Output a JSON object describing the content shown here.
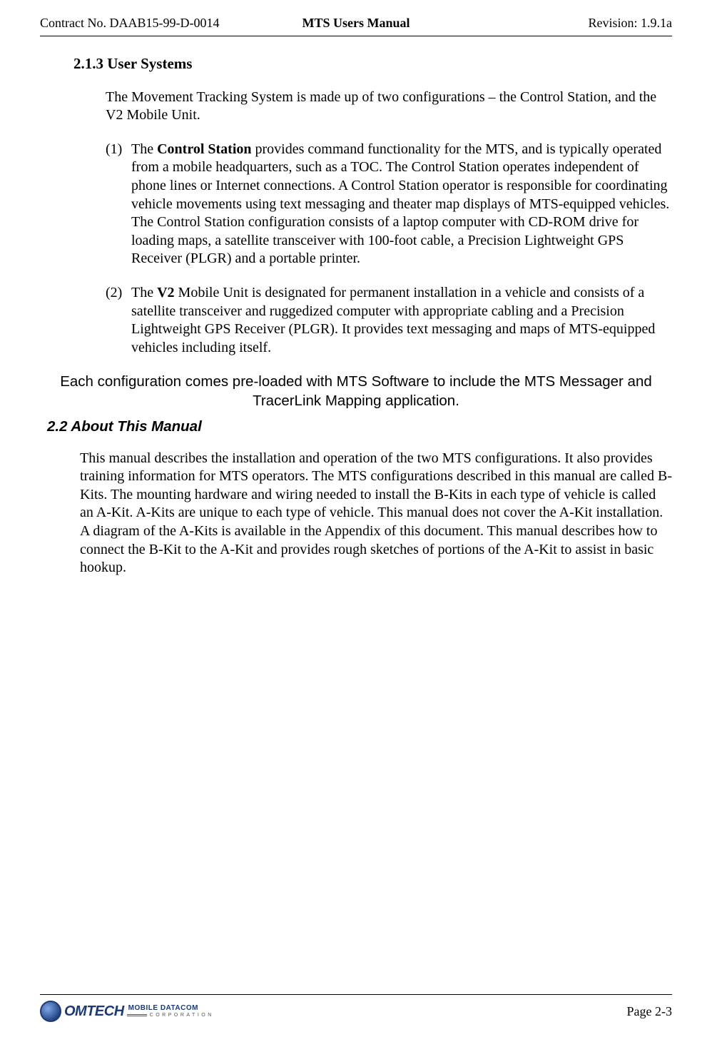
{
  "header": {
    "left": "Contract No. DAAB15-99-D-0014",
    "center": "MTS Users Manual",
    "right": "Revision:  1.9.1a"
  },
  "section_213": {
    "heading": "2.1.3  User Systems",
    "intro": "The Movement Tracking System is made up of two configurations – the Control Station, and the V2 Mobile Unit.",
    "items": [
      {
        "marker": "(1)",
        "bold_lead": "Control Station",
        "pre_bold": "The ",
        "post_bold": " provides command functionality for the MTS, and is typically operated from a mobile headquarters, such as a TOC.  The Control Station operates independent of phone lines or Internet connections.  A Control Station operator is responsible for coordinating vehicle movements using text messaging and theater map displays of MTS-equipped vehicles.  The Control Station configuration consists of a laptop computer with CD-ROM drive for loading maps, a satellite transceiver with 100-foot cable, a Precision Lightweight GPS Receiver (PLGR) and a portable printer."
      },
      {
        "marker": "(2)",
        "bold_lead": "V2",
        "pre_bold": "The ",
        "post_bold": " Mobile Unit is designated for permanent installation in a vehicle and consists of a satellite transceiver and ruggedized computer with appropriate cabling and a Precision Lightweight GPS Receiver (PLGR).  It provides text messaging and maps of MTS-equipped vehicles including itself."
      }
    ]
  },
  "note": "Each configuration comes pre-loaded with MTS Software to include the MTS Messager and TracerLink Mapping application.",
  "section_22": {
    "heading": "2.2  About This Manual",
    "para": "This manual describes the installation and operation of the two MTS configurations. It also provides training information for MTS operators.  The MTS configurations described in this manual are called B-Kits.  The mounting hardware and wiring needed to install the B-Kits in each type of vehicle is called an A-Kit.  A-Kits are unique to each type of vehicle.  This manual does not cover the A-Kit installation.  A diagram of the A-Kits is available in the Appendix of this document.  This manual describes how to connect the B-Kit to the A-Kit and provides rough sketches of portions of the A-Kit to assist in basic hookup."
  },
  "footer": {
    "page": "Page 2-3",
    "logo_main": "OMTECH",
    "logo_sub": "MOBILE DATACOM",
    "logo_corp": "CORPORATION"
  }
}
